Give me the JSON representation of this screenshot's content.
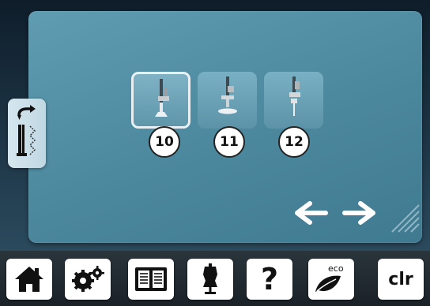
{
  "presser_feet": [
    {
      "number": "10",
      "selected": true
    },
    {
      "number": "11",
      "selected": false
    },
    {
      "number": "12",
      "selected": false
    }
  ],
  "side_tab": {
    "icon": "presser-foot-stitch-icon"
  },
  "navigation": {
    "back_icon": "arrow-left-icon",
    "forward_icon": "arrow-right-icon"
  },
  "toolbar": {
    "home_icon": "home-icon",
    "settings_icon": "gears-icon",
    "tutorial_icon": "book-icon",
    "consultant_icon": "dress-form-icon",
    "help_label": "?",
    "eco_label": "eco",
    "clear_label": "clr"
  },
  "colors": {
    "panel": "#5f9bb1",
    "tile": "#7ab0c3",
    "selected_border": "#e9f0f4",
    "toolbar_button": "#ffffff"
  }
}
